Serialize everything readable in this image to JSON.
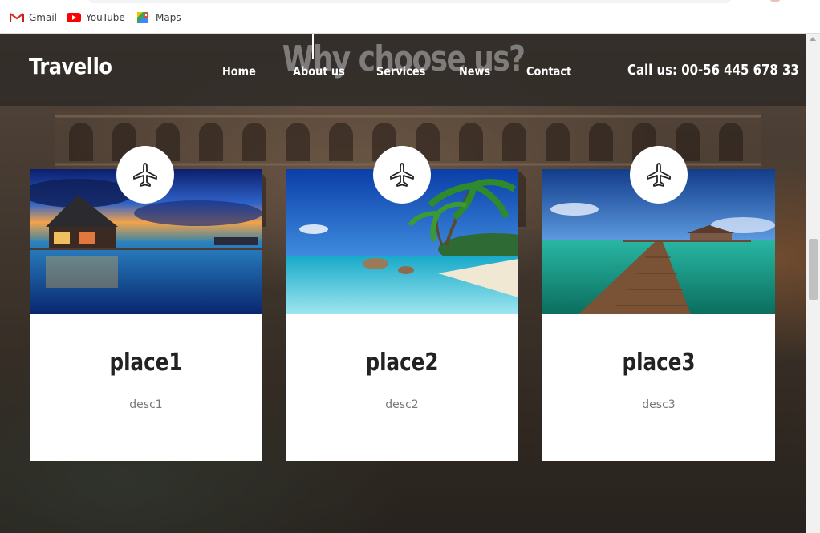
{
  "bookmarks": [
    {
      "label": "Gmail",
      "icon": "gmail-icon"
    },
    {
      "label": "YouTube",
      "icon": "youtube-icon"
    },
    {
      "label": "Maps",
      "icon": "maps-icon"
    }
  ],
  "site": {
    "brand": "Travello",
    "nav": [
      "Home",
      "About us",
      "Services",
      "News",
      "Contact"
    ],
    "call": "Call us: 00-56 445 678 33"
  },
  "section": {
    "title": "Why choose us?"
  },
  "cards": [
    {
      "title": "place1",
      "desc": "desc1",
      "icon": "airplane-icon"
    },
    {
      "title": "place2",
      "desc": "desc2",
      "icon": "airplane-icon"
    },
    {
      "title": "place3",
      "desc": "desc3",
      "icon": "airplane-icon"
    }
  ],
  "colors": {
    "nav_bg": "#2d2a26",
    "card_bg": "#ffffff",
    "title_text": "#222222",
    "desc_text": "#777777"
  }
}
